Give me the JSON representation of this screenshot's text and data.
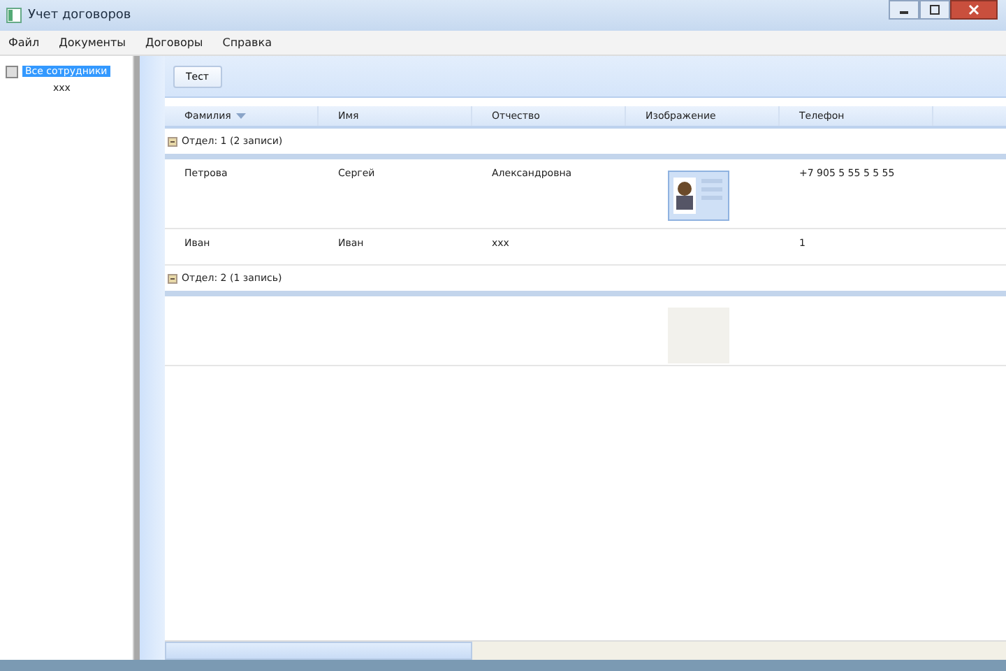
{
  "window": {
    "title": "Учет договоров"
  },
  "menu": [
    {
      "label": "Файл"
    },
    {
      "label": "Документы"
    },
    {
      "label": "Договоры"
    },
    {
      "label": "Справка"
    }
  ],
  "tree": [
    {
      "label": "Все сотрудники",
      "selected": true
    },
    {
      "label": "ххх",
      "selected": false
    }
  ],
  "toolbar": {
    "buttons": [
      "Тест"
    ]
  },
  "table": {
    "columns": [
      {
        "label": "Фамилия",
        "sorted": true
      },
      {
        "label": "Имя",
        "sorted": false
      },
      {
        "label": "Отчество",
        "sorted": false
      },
      {
        "label": "Изображение",
        "sorted": false
      },
      {
        "label": "Телефон",
        "sorted": false
      }
    ],
    "groups": [
      {
        "label": "Отдел: 1 (2 записи)",
        "expanded": true,
        "rows": [
          {
            "cells": [
              "Петрова",
              "Сергей",
              "Александровна"
            ],
            "kind": "photo",
            "phone": "+7 905 5 55 5 5 55"
          },
          {
            "cells": [
              "Иван",
              "Иван",
              "ххх"
            ],
            "kind": "text",
            "phone": "1"
          }
        ]
      },
      {
        "label": "Отдел: 2 (1 запись)",
        "expanded": true,
        "rows": [
          {
            "cells": [],
            "kind": "blank-photo"
          }
        ]
      }
    ]
  }
}
